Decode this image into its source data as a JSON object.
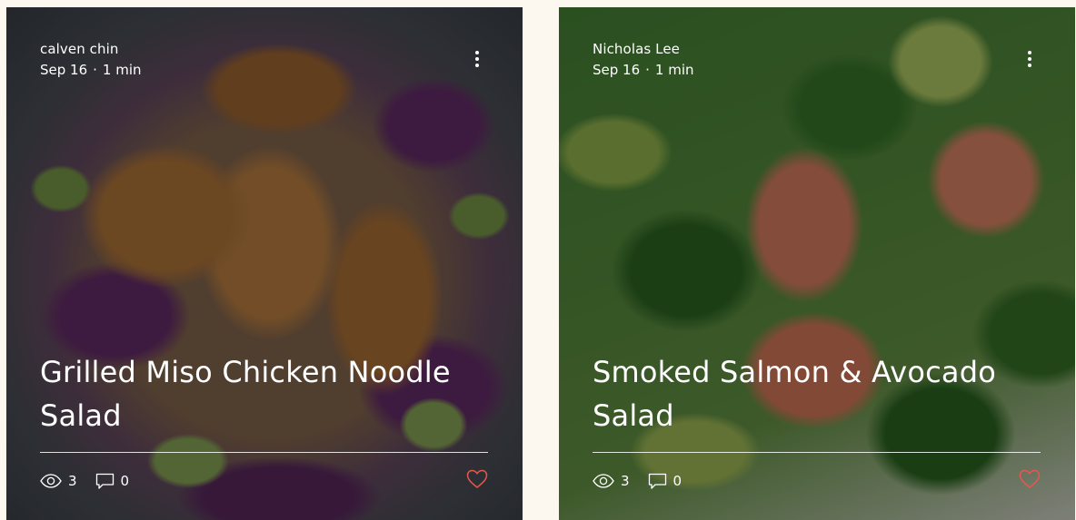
{
  "posts": [
    {
      "author": "calven chin",
      "date": "Sep 16",
      "separator": "·",
      "read_time": "1 min",
      "title": "Grilled Miso Chicken Noodle Salad",
      "views": "3",
      "comments": "0",
      "icons": {
        "menu": "more-vertical-icon",
        "views": "eye-icon",
        "comments": "comment-icon",
        "like": "heart-icon"
      }
    },
    {
      "author": "Nicholas Lee",
      "date": "Sep 16",
      "separator": "·",
      "read_time": "1 min",
      "title": "Smoked Salmon & Avocado Salad",
      "views": "3",
      "comments": "0",
      "icons": {
        "menu": "more-vertical-icon",
        "views": "eye-icon",
        "comments": "comment-icon",
        "like": "heart-icon"
      }
    }
  ],
  "colors": {
    "background": "#fdf8ef",
    "text": "#ffffff",
    "like": "#e8574b"
  }
}
